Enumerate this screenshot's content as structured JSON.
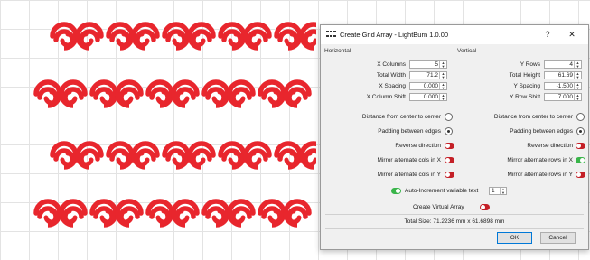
{
  "canvas": {
    "shape_color": "#e8262d",
    "grid_color": "#e3e3e3"
  },
  "dialog": {
    "title": "Create Grid Array - LightBurn 1.0.00",
    "help_label": "?",
    "close_label": "✕",
    "horizontal": {
      "heading": "Horizontal",
      "rows": [
        {
          "label": "X Columns",
          "value": "5"
        },
        {
          "label": "Total Width",
          "value": "71.2"
        },
        {
          "label": "X Spacing",
          "value": "0.000"
        },
        {
          "label": "X Column Shift",
          "value": "0.000"
        }
      ],
      "distance_label": "Distance from center to center",
      "distance_selected": false,
      "padding_label": "Padding between edges",
      "padding_selected": true,
      "reverse_label": "Reverse direction",
      "reverse_on": false,
      "mirror_x_label": "Mirror alternate cols in X",
      "mirror_x_on": false,
      "mirror_y_label": "Mirror alternate cols in Y",
      "mirror_y_on": false
    },
    "vertical": {
      "heading": "Vertical",
      "rows": [
        {
          "label": "Y Rows",
          "value": "4"
        },
        {
          "label": "Total Height",
          "value": "61.69"
        },
        {
          "label": "Y Spacing",
          "value": "-1.500"
        },
        {
          "label": "Y Row Shift",
          "value": "7.000"
        }
      ],
      "distance_label": "Distance from center to center",
      "distance_selected": false,
      "padding_label": "Padding between edges",
      "padding_selected": true,
      "reverse_label": "Reverse direction",
      "reverse_on": false,
      "mirror_x_label": "Mirror alternate rows in X",
      "mirror_x_on": true,
      "mirror_y_label": "Mirror alternate rows in Y",
      "mirror_y_on": false
    },
    "auto_increment": {
      "label": "Auto-Increment variable text",
      "on": true,
      "value": "1"
    },
    "virtual_array": {
      "label": "Create Virtual Array",
      "on": false
    },
    "total_size": "Total Size: 71.2236 mm x 61.6898 mm",
    "ok_label": "OK",
    "cancel_label": "Cancel"
  }
}
